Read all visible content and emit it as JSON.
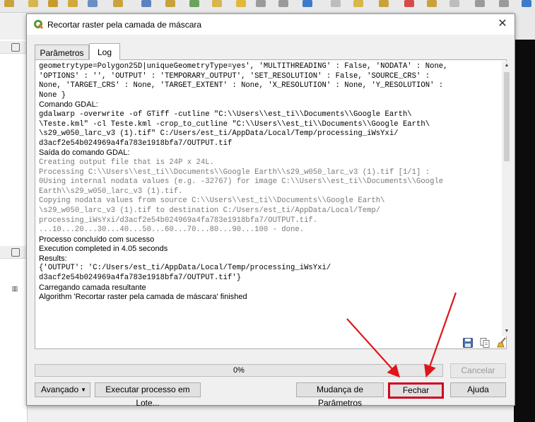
{
  "dialog": {
    "title": "Recortar raster pela camada de máscara",
    "close_glyph": "✕"
  },
  "tabs": [
    {
      "label": "Parâmetros",
      "active": false
    },
    {
      "label": "Log",
      "active": true
    }
  ],
  "log_lines": [
    {
      "text": "geometrytype=Polygon25D|uniqueGeometryType=yes', 'MULTITHREADING' : False, 'NODATA' : None,",
      "style": "mono"
    },
    {
      "text": "'OPTIONS' : '', 'OUTPUT' : 'TEMPORARY_OUTPUT', 'SET_RESOLUTION' : False, 'SOURCE_CRS' :",
      "style": "mono"
    },
    {
      "text": "None, 'TARGET_CRS' : None, 'TARGET_EXTENT' : None, 'X_RESOLUTION' : None, 'Y_RESOLUTION' :",
      "style": "mono"
    },
    {
      "text": "None }",
      "style": "mono"
    },
    {
      "text": "",
      "style": "sans"
    },
    {
      "text": "Comando GDAL:",
      "style": "sans"
    },
    {
      "text": "gdalwarp -overwrite -of GTiff -cutline \"C:\\\\Users\\\\est_ti\\\\Documents\\\\Google Earth\\",
      "style": "mono"
    },
    {
      "text": "\\Teste.kml\" -cl Teste.kml -crop_to_cutline \"C:\\\\Users\\\\est_ti\\\\Documents\\\\Google Earth\\",
      "style": "mono"
    },
    {
      "text": "\\s29_w050_larc_v3 (1).tif\" C:/Users/est_ti/AppData/Local/Temp/processing_iWsYxi/",
      "style": "mono"
    },
    {
      "text": "d3acf2e54b024969a4fa783e1918bfa7/OUTPUT.tif",
      "style": "mono"
    },
    {
      "text": "Saída do comando GDAL:",
      "style": "sans"
    },
    {
      "text": "Creating output file that is 24P x 24L.",
      "style": "mono-gray"
    },
    {
      "text": "Processing C:\\\\Users\\\\est_ti\\\\Documents\\\\Google Earth\\\\s29_w050_larc_v3 (1).tif [1/1] :",
      "style": "mono-gray"
    },
    {
      "text": "0Using internal nodata values (e.g. -32767) for image C:\\\\Users\\\\est_ti\\\\Documents\\\\Google",
      "style": "mono-gray"
    },
    {
      "text": "Earth\\\\s29_w050_larc_v3 (1).tif.",
      "style": "mono-gray"
    },
    {
      "text": "Copying nodata values from source C:\\\\Users\\\\est_ti\\\\Documents\\\\Google Earth\\",
      "style": "mono-gray"
    },
    {
      "text": "\\s29_w050_larc_v3 (1).tif to destination C:/Users/est_ti/AppData/Local/Temp/",
      "style": "mono-gray"
    },
    {
      "text": "processing_iWsYxi/d3acf2e54b024969a4fa783e1918bfa7/OUTPUT.tif.",
      "style": "mono-gray"
    },
    {
      "text": "...10...20...30...40...50...60...70...80...90...100 - done.",
      "style": "mono-gray"
    },
    {
      "text": "Processo concluído com sucesso",
      "style": "sans"
    },
    {
      "text": "Execution completed in 4.05 seconds",
      "style": "sans"
    },
    {
      "text": "Results:",
      "style": "sans"
    },
    {
      "text": "{'OUTPUT': 'C:/Users/est_ti/AppData/Local/Temp/processing_iWsYxi/",
      "style": "mono"
    },
    {
      "text": "d3acf2e54b024969a4fa783e1918bfa7/OUTPUT.tif'}",
      "style": "mono"
    },
    {
      "text": "",
      "style": "sans"
    },
    {
      "text": "Carregando camada resultante",
      "style": "sans"
    },
    {
      "text": "Algorithm 'Recortar raster pela camada de máscara' finished",
      "style": "sans"
    }
  ],
  "progress": {
    "label": "0%",
    "value": 0
  },
  "buttons": {
    "cancelar": "Cancelar",
    "avancado": "Avançado",
    "lote": "Executar processo em Lote...",
    "mudanca": "Mudança de Parâmetros",
    "fechar": "Fechar",
    "ajuda": "Ajuda"
  },
  "icons": {
    "save": "save-icon",
    "copy": "copy-icon",
    "clear": "broom-icon"
  },
  "colors": {
    "annotation": "#e0151b",
    "progress": "#06b025"
  }
}
